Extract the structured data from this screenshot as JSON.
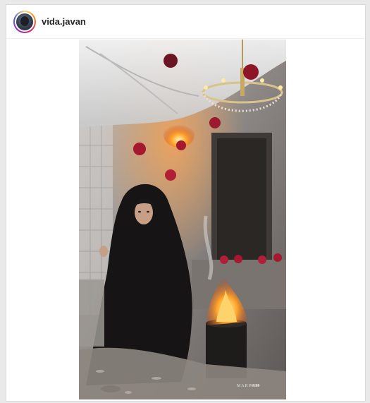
{
  "post": {
    "username": "vida.javan",
    "photo_watermark": "MARYAM"
  },
  "icons": {
    "avatar": "profile-avatar"
  },
  "colors": {
    "username": "#262626",
    "border": "#dbdbdb",
    "ring_start": "#feda75",
    "ring_end": "#4f5bd5"
  }
}
